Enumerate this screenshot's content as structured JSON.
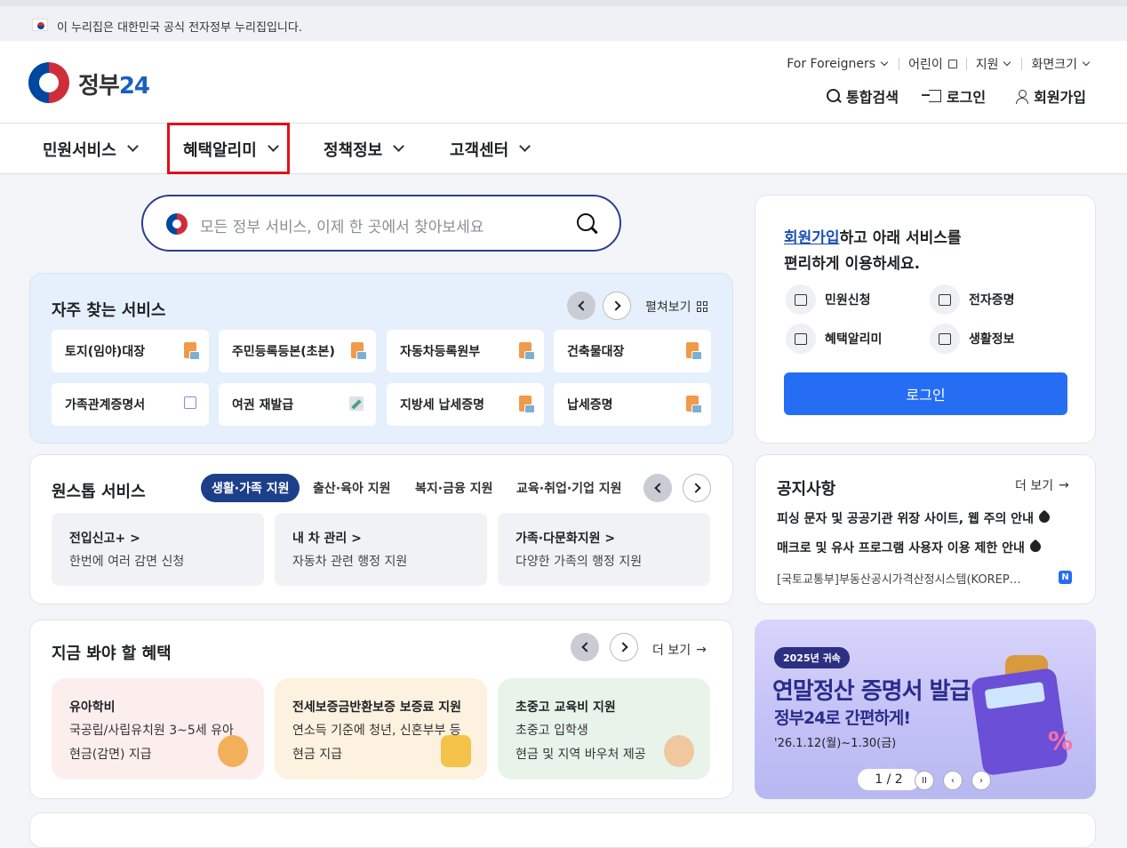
{
  "gov_banner": {
    "text": "이 누리집은 대한민국 공식 전자정부 누리집입니다."
  },
  "logo": {
    "text_main": "정부",
    "text_num": "24"
  },
  "utility_nav": [
    {
      "label": "For Foreigners"
    },
    {
      "label": "어린이"
    },
    {
      "label": "지원"
    },
    {
      "label": "화면크기"
    }
  ],
  "header_actions": {
    "search": "통합검색",
    "login": "로그인",
    "signup": "회원가입"
  },
  "gnb": [
    "민원서비스",
    "혜택알리미",
    "정책정보",
    "고객센터"
  ],
  "search": {
    "placeholder": "모든 정부 서비스, 이제 한 곳에서 찾아보세요"
  },
  "frequent": {
    "title": "자주 찾는 서비스",
    "expand_label": "펼쳐보기",
    "items": [
      "토지(임야)대장",
      "주민등록등본(초본)",
      "자동차등록원부",
      "건축물대장",
      "가족관계증명서",
      "여권 재발급",
      "지방세 납세증명",
      "납세증명"
    ]
  },
  "onestop": {
    "title": "원스톱 서비스",
    "tabs": [
      "생활·가족 지원",
      "출산·육아 지원",
      "복지·금융 지원",
      "교육·취업·기업 지원"
    ],
    "cards": [
      {
        "title": "전입신고+",
        "desc": "한번에 여러 감면 신청"
      },
      {
        "title": "내 차 관리",
        "desc": "자동차 관련 행정 지원"
      },
      {
        "title": "가족·다문화지원",
        "desc": "다양한 가족의 행정 지원"
      }
    ]
  },
  "benefits": {
    "title": "지금 봐야 할 혜택",
    "more": "더 보기",
    "cards": [
      {
        "title": "유아학비",
        "line1": "국공립/사립유치원 3~5세 유아",
        "line2": "현금(감면) 지급",
        "bg": "#fdeeee"
      },
      {
        "title": "전세보증금반환보증 보증료 지원",
        "line1": "연소득 기준에 청년, 신혼부부 등",
        "line2": "현금 지급",
        "bg": "#fdf1df"
      },
      {
        "title": "초중고 교육비 지원",
        "line1": "초중고 입학생",
        "line2": "현금 및 지역 바우처 제공",
        "bg": "#e8f4ea"
      }
    ]
  },
  "member": {
    "link": "회원가입",
    "msg1": "하고 아래 서비스를",
    "msg2": "편리하게 이용하세요.",
    "quick": [
      "민원신청",
      "전자증명",
      "혜택알리미",
      "생활정보"
    ],
    "login_button": "로그인"
  },
  "notice": {
    "title": "공지사항",
    "more": "더 보기",
    "items": [
      "피싱 문자 및 공공기관 위장 사이트, 웹 주의 안내",
      "매크로 및 유사 프로그램 사용자 이용 제한 안내"
    ],
    "latest": "[국토교통부]부동산공시가격산정시스템(KOREP…",
    "new_badge": "N"
  },
  "promo": {
    "pill": "2025년 귀속",
    "headline": "연말정산 증명서 발급",
    "sub": "정부24로 간편하게!",
    "date": "'26.1.12(월)~1.30(금)",
    "pager": "1 / 2"
  },
  "colors": {
    "primary": "#256ef4",
    "navy": "#1d3f8a",
    "highlight": "#e0101a"
  }
}
